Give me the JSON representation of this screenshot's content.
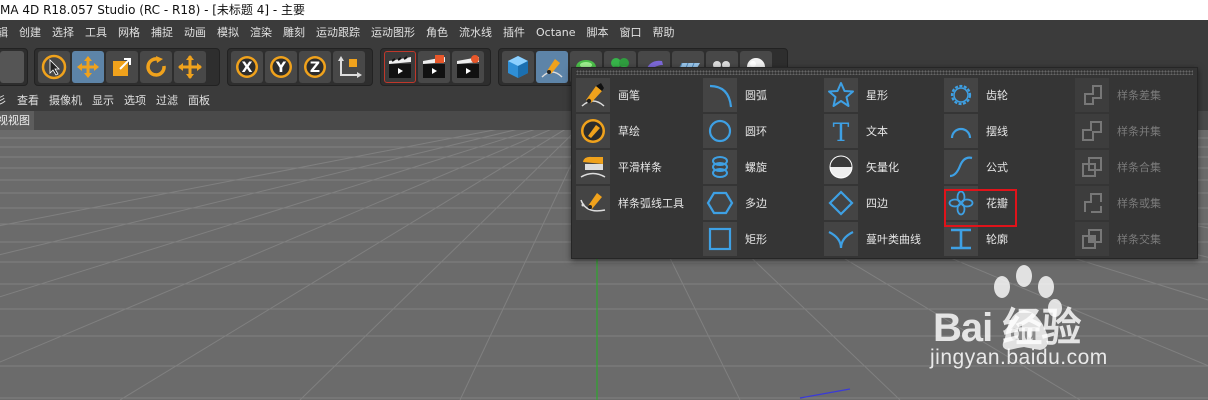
{
  "window": {
    "title": "MA 4D R18.057 Studio (RC - R18) - [未标题 4] - 主要"
  },
  "menubar": {
    "items": [
      "辑",
      "创建",
      "选择",
      "工具",
      "网格",
      "捕捉",
      "动画",
      "模拟",
      "渲染",
      "雕刻",
      "运动跟踪",
      "运动图形",
      "角色",
      "流水线",
      "插件",
      "Octane",
      "脚本",
      "窗口",
      "帮助"
    ]
  },
  "toolbar": {
    "groups": [
      {
        "name": "transform",
        "buttons": [
          "select-icon",
          "move-icon",
          "scale-icon",
          "rotate-icon",
          "move-last-icon"
        ]
      },
      {
        "name": "axis-lock",
        "buttons": [
          "x-axis-icon",
          "y-axis-icon",
          "z-axis-icon",
          "coordinate-system-icon"
        ]
      },
      {
        "name": "render",
        "buttons": [
          "render-view-icon",
          "render-picture-viewer-icon",
          "render-settings-icon"
        ]
      },
      {
        "name": "objects",
        "buttons": [
          "cube-icon",
          "pen-spline-icon",
          "nurbs-icon",
          "array-icon",
          "deformer-icon",
          "floor-icon",
          "camera-icon",
          "light-icon"
        ]
      }
    ]
  },
  "viewport_menu": {
    "items": [
      "彡",
      "查看",
      "摄像机",
      "显示",
      "选项",
      "过滤",
      "面板"
    ]
  },
  "viewport": {
    "title": "视视图"
  },
  "spline_menu": {
    "columns": [
      [
        {
          "label": "画笔",
          "icon": "pen-tool-icon"
        },
        {
          "label": "草绘",
          "icon": "sketch-icon"
        },
        {
          "label": "平滑样条",
          "icon": "smooth-spline-icon"
        },
        {
          "label": "样条弧线工具",
          "icon": "spline-arc-tool-icon"
        }
      ],
      [
        {
          "label": "圆弧",
          "icon": "arc-icon"
        },
        {
          "label": "圆环",
          "icon": "circle-icon"
        },
        {
          "label": "螺旋",
          "icon": "helix-icon"
        },
        {
          "label": "多边",
          "icon": "polygon-icon"
        },
        {
          "label": "矩形",
          "icon": "rectangle-icon"
        }
      ],
      [
        {
          "label": "星形",
          "icon": "star-icon"
        },
        {
          "label": "文本",
          "icon": "text-icon"
        },
        {
          "label": "矢量化",
          "icon": "vectorizer-icon"
        },
        {
          "label": "四边",
          "icon": "four-side-icon"
        },
        {
          "label": "蔓叶类曲线",
          "icon": "cissoid-icon"
        }
      ],
      [
        {
          "label": "齿轮",
          "icon": "cogwheel-icon"
        },
        {
          "label": "摆线",
          "icon": "cycloid-icon"
        },
        {
          "label": "公式",
          "icon": "formula-icon"
        },
        {
          "label": "花瓣",
          "icon": "flower-icon"
        },
        {
          "label": "轮廓",
          "icon": "profile-icon"
        }
      ],
      [
        {
          "label": "样条差集",
          "icon": "spline-subtract-icon"
        },
        {
          "label": "样条并集",
          "icon": "spline-union-icon"
        },
        {
          "label": "样条合集",
          "icon": "spline-and-icon"
        },
        {
          "label": "样条或集",
          "icon": "spline-or-icon"
        },
        {
          "label": "样条交集",
          "icon": "spline-intersect-icon"
        }
      ]
    ],
    "highlighted": "花瓣"
  },
  "watermark": {
    "brand": "Bai 经验",
    "url": "jingyan.baidu.com"
  },
  "colors": {
    "accent": "#5d84a8",
    "orange": "#f0a21c",
    "blue_icon": "#3ea0e4",
    "highlight": "#e0131a"
  }
}
